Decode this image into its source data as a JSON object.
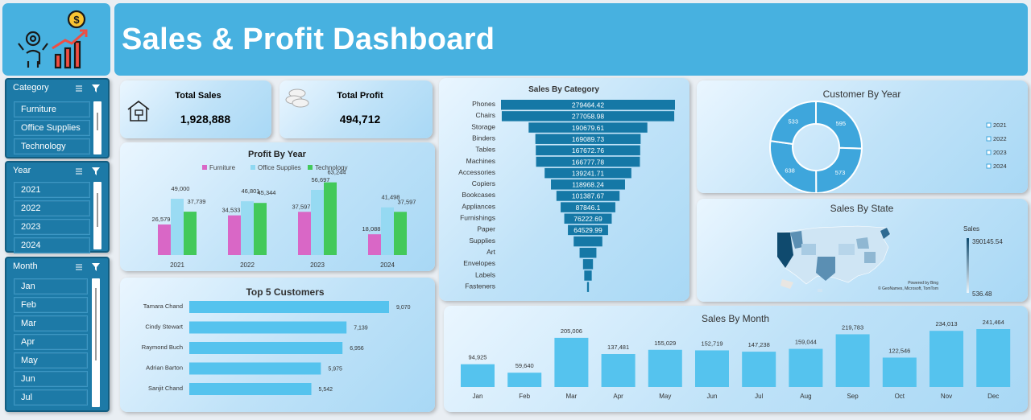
{
  "header": {
    "title": "Sales & Profit Dashboard"
  },
  "slicers": {
    "category": {
      "title": "Category",
      "items": [
        "Furniture",
        "Office Supplies",
        "Technology"
      ]
    },
    "year": {
      "title": "Year",
      "items": [
        "2021",
        "2022",
        "2023",
        "2024"
      ]
    },
    "month": {
      "title": "Month",
      "items": [
        "Jan",
        "Feb",
        "Mar",
        "Apr",
        "May",
        "Jun",
        "Jul"
      ]
    }
  },
  "kpis": {
    "total_sales": {
      "label": "Total Sales",
      "value": "1,928,888"
    },
    "total_profit": {
      "label": "Total Profit",
      "value": "494,712"
    }
  },
  "colors": {
    "furniture": "#d967c6",
    "office_supplies": "#8fd8f1",
    "technology": "#43c95a",
    "bar_blue": "#55c3ee",
    "funnel": "#1578a6"
  },
  "map_legend": {
    "title": "Sales",
    "max": "390145.54",
    "min": "536.48",
    "credit_line1": "Powered by Bing",
    "credit_line2": "© GeoNames, Microsoft, TomTom"
  },
  "chart_data": [
    {
      "type": "bar",
      "title": "Profit By Year",
      "categories": [
        "2021",
        "2022",
        "2023",
        "2024"
      ],
      "series": [
        {
          "name": "Furniture",
          "values": [
            26579,
            34533,
            37597,
            18088
          ],
          "labels": [
            "26,579",
            "34,533",
            "37,597",
            "18,088"
          ]
        },
        {
          "name": "Office Supplies",
          "values": [
            49000,
            46801,
            56697,
            41498
          ],
          "labels": [
            "49,000",
            "46,801",
            "56,697",
            "41,498"
          ]
        },
        {
          "name": "Technology",
          "values": [
            37739,
            45344,
            63244,
            37597
          ],
          "labels": [
            "37,739",
            "45,344",
            "63,244",
            "37,597"
          ]
        }
      ],
      "legend": "top"
    },
    {
      "type": "bar",
      "orientation": "horizontal",
      "title": "Top 5 Customers",
      "categories": [
        "Tamara Chand",
        "Cindy Stewart",
        "Raymond Buch",
        "Adrian Barton",
        "Sanjit Chand"
      ],
      "values": [
        9070,
        7139,
        6956,
        5975,
        5542
      ],
      "labels": [
        "9,070",
        "7,139",
        "6,956",
        "5,975",
        "5,542"
      ]
    },
    {
      "type": "bar",
      "orientation": "funnel",
      "title": "Sales By Category",
      "categories": [
        "Phones",
        "Chairs",
        "Storage",
        "Binders",
        "Tables",
        "Machines",
        "Accessories",
        "Copiers",
        "Bookcases",
        "Appliances",
        "Furnishings",
        "Paper",
        "Supplies",
        "Art",
        "Envelopes",
        "Labels",
        "Fasteners"
      ],
      "values": [
        279464.42,
        277058.98,
        190679.61,
        169089.73,
        167672.76,
        166777.78,
        139241.71,
        118968.24,
        101387.67,
        87846.1,
        76222.69,
        64529.99,
        46000,
        27000,
        16000,
        12000,
        3000
      ],
      "labels": [
        "279464.42",
        "277058.98",
        "190679.61",
        "169089.73",
        "167672.76",
        "166777.78",
        "139241.71",
        "118968.24",
        "101387.67",
        "87846.1",
        "76222.69",
        "64529.99",
        "",
        "",
        "",
        "",
        ""
      ]
    },
    {
      "type": "pie",
      "title": "Customer By Year",
      "categories": [
        "2021",
        "2022",
        "2023",
        "2024"
      ],
      "values": [
        595,
        573,
        638,
        533
      ],
      "colors": [
        "#3ea6dc",
        "#3ea6dc",
        "#3ea6dc",
        "#3ea6dc"
      ],
      "legend": "right"
    },
    {
      "type": "bar",
      "title": "Sales By Month",
      "categories": [
        "Jan",
        "Feb",
        "Mar",
        "Apr",
        "May",
        "Jun",
        "Jul",
        "Aug",
        "Sep",
        "Oct",
        "Nov",
        "Dec"
      ],
      "values": [
        94925,
        59640,
        205006,
        137481,
        155029,
        152719,
        147238,
        159044,
        219783,
        122546,
        234013,
        241464
      ],
      "labels": [
        "94,925",
        "59,640",
        "205,006",
        "137,481",
        "155,029",
        "152,719",
        "147,238",
        "159,044",
        "219,783",
        "122,546",
        "234,013",
        "241,464"
      ]
    },
    {
      "type": "heatmap",
      "title": "Sales By State",
      "legend": "right"
    }
  ]
}
